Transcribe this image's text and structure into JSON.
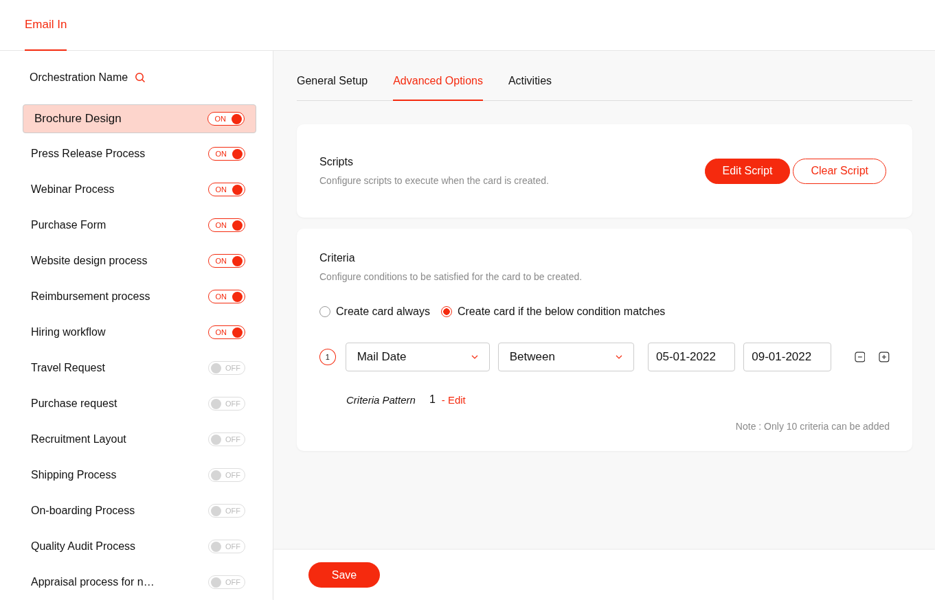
{
  "header": {
    "tab": "Email In"
  },
  "sidebar": {
    "heading": "Orchestration Name",
    "items": [
      {
        "name": "Brochure Design",
        "selected": true,
        "on": true,
        "toggle_label": "ON"
      },
      {
        "name": "Press Release Process",
        "selected": false,
        "on": true,
        "toggle_label": "ON"
      },
      {
        "name": "Webinar Process",
        "selected": false,
        "on": true,
        "toggle_label": "ON"
      },
      {
        "name": "Purchase Form",
        "selected": false,
        "on": true,
        "toggle_label": "ON"
      },
      {
        "name": "Website design process",
        "selected": false,
        "on": true,
        "toggle_label": "ON"
      },
      {
        "name": "Reimbursement process",
        "selected": false,
        "on": true,
        "toggle_label": "ON"
      },
      {
        "name": "Hiring workflow",
        "selected": false,
        "on": true,
        "toggle_label": "ON"
      },
      {
        "name": "Travel Request",
        "selected": false,
        "on": false,
        "toggle_label": "OFF"
      },
      {
        "name": "Purchase request",
        "selected": false,
        "on": false,
        "toggle_label": "OFF"
      },
      {
        "name": "Recruitment Layout",
        "selected": false,
        "on": false,
        "toggle_label": "OFF"
      },
      {
        "name": "Shipping Process",
        "selected": false,
        "on": false,
        "toggle_label": "OFF"
      },
      {
        "name": "On-boarding Process",
        "selected": false,
        "on": false,
        "toggle_label": "OFF"
      },
      {
        "name": "Quality Audit Process",
        "selected": false,
        "on": false,
        "toggle_label": "OFF"
      },
      {
        "name": "Appraisal process for n…",
        "selected": false,
        "on": false,
        "toggle_label": "OFF"
      }
    ]
  },
  "tabs": [
    {
      "label": "General Setup",
      "selected": false
    },
    {
      "label": "Advanced Options",
      "selected": true
    },
    {
      "label": "Activities",
      "selected": false
    }
  ],
  "scripts": {
    "title": "Scripts",
    "description": "Configure scripts to execute when the card is created.",
    "buttons": [
      {
        "label": "Edit Script",
        "kind": "primary"
      },
      {
        "label": "Clear Script",
        "kind": "outline"
      }
    ]
  },
  "criteria": {
    "title": "Criteria",
    "description": "Configure conditions to be satisfied for the card to be created.",
    "options": [
      {
        "label": "Create card always",
        "selected": false
      },
      {
        "label": "Create card if the below condition matches",
        "selected": true
      }
    ],
    "rows": [
      {
        "number": "1",
        "field": "Mail Date",
        "operator": "Between",
        "from": "05-01-2022",
        "to": "09-01-2022"
      }
    ],
    "pattern_label": "Criteria Pattern",
    "pattern": "1",
    "pattern_edit": "- Edit",
    "note": "Note : Only 10 criteria can be added"
  },
  "footer": {
    "save": "Save"
  }
}
